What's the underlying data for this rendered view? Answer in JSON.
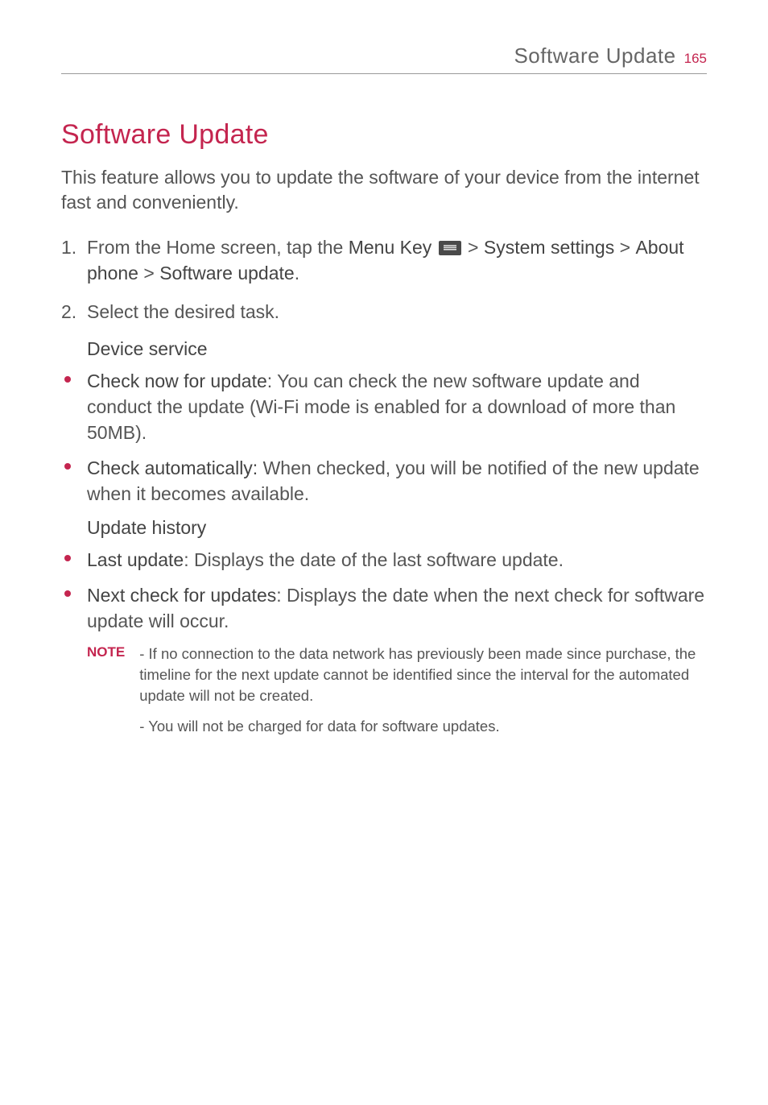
{
  "header": {
    "title": "Software Update",
    "page_number": "165"
  },
  "section": {
    "title": "Software Update",
    "intro": "This feature allows you to update the software of your device from the internet fast and conveniently."
  },
  "steps": {
    "step1": {
      "prefix": "From the Home screen, tap the ",
      "menu_key": "Menu Key",
      "system_settings": "System settings",
      "about_phone": "About phone",
      "software_update": "Software update"
    },
    "step2": "Select the desired task."
  },
  "device_service": {
    "heading": "Device service",
    "check_now": {
      "label": "Check now for update",
      "desc": ": You can check the new software update and conduct the update (Wi-Fi mode is enabled for a download of more than 50MB)."
    },
    "check_auto": {
      "label": "Check automatically:",
      "desc": " When checked, you will be notified of the new update when it becomes available."
    }
  },
  "update_history": {
    "heading": "Update history",
    "last_update": {
      "label": "Last update",
      "desc": ": Displays the date of the last software update."
    },
    "next_check": {
      "label": "Next check for updates",
      "desc": ": Displays the date when the next check for software update will occur."
    }
  },
  "note": {
    "label": "NOTE",
    "line1": "- If no connection to the data network has previously been made since purchase, the timeline for the next update cannot be identified since the interval for the automated update will not be created.",
    "line2": "- You will not be charged for data for software updates."
  }
}
